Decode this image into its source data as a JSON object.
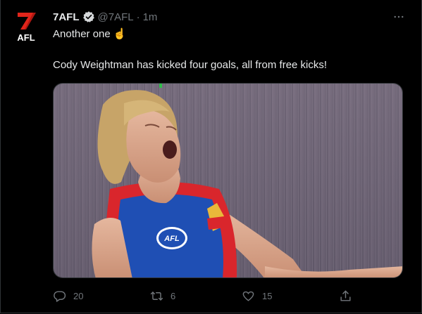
{
  "tweet": {
    "author_name": "7AFL",
    "handle": "@7AFL",
    "separator": "·",
    "time": "1m",
    "line1": "Another one",
    "line1_emoji": "☝️",
    "line2": "Cody Weightman has kicked four goals, all from free kicks!",
    "logo_text": "AFL",
    "logo_number": "7"
  },
  "actions": {
    "replies": "20",
    "retweets": "6",
    "likes": "15"
  },
  "icons": {
    "avatar": "7afl-logo",
    "verified": "verified-badge-icon",
    "more": "more-icon",
    "reply": "reply-icon",
    "retweet": "retweet-icon",
    "like": "heart-icon",
    "share": "share-icon"
  },
  "colors": {
    "background": "#000000",
    "text": "#e7e9ea",
    "muted": "#71767b",
    "logo_red": "#e1251b",
    "jersey_blue": "#1f4fb4",
    "jersey_red": "#d9262c"
  }
}
